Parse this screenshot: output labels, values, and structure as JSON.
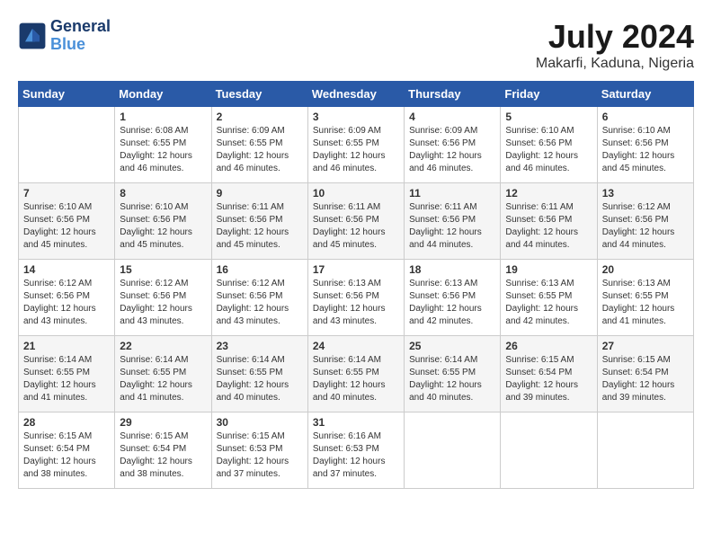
{
  "header": {
    "logo_line1": "General",
    "logo_line2": "Blue",
    "month_year": "July 2024",
    "location": "Makarfi, Kaduna, Nigeria"
  },
  "calendar": {
    "days_of_week": [
      "Sunday",
      "Monday",
      "Tuesday",
      "Wednesday",
      "Thursday",
      "Friday",
      "Saturday"
    ],
    "weeks": [
      [
        {
          "day": "",
          "sunrise": "",
          "sunset": "",
          "daylight": ""
        },
        {
          "day": "1",
          "sunrise": "Sunrise: 6:08 AM",
          "sunset": "Sunset: 6:55 PM",
          "daylight": "Daylight: 12 hours and 46 minutes."
        },
        {
          "day": "2",
          "sunrise": "Sunrise: 6:09 AM",
          "sunset": "Sunset: 6:55 PM",
          "daylight": "Daylight: 12 hours and 46 minutes."
        },
        {
          "day": "3",
          "sunrise": "Sunrise: 6:09 AM",
          "sunset": "Sunset: 6:55 PM",
          "daylight": "Daylight: 12 hours and 46 minutes."
        },
        {
          "day": "4",
          "sunrise": "Sunrise: 6:09 AM",
          "sunset": "Sunset: 6:56 PM",
          "daylight": "Daylight: 12 hours and 46 minutes."
        },
        {
          "day": "5",
          "sunrise": "Sunrise: 6:10 AM",
          "sunset": "Sunset: 6:56 PM",
          "daylight": "Daylight: 12 hours and 46 minutes."
        },
        {
          "day": "6",
          "sunrise": "Sunrise: 6:10 AM",
          "sunset": "Sunset: 6:56 PM",
          "daylight": "Daylight: 12 hours and 45 minutes."
        }
      ],
      [
        {
          "day": "7",
          "sunrise": "Sunrise: 6:10 AM",
          "sunset": "Sunset: 6:56 PM",
          "daylight": "Daylight: 12 hours and 45 minutes."
        },
        {
          "day": "8",
          "sunrise": "Sunrise: 6:10 AM",
          "sunset": "Sunset: 6:56 PM",
          "daylight": "Daylight: 12 hours and 45 minutes."
        },
        {
          "day": "9",
          "sunrise": "Sunrise: 6:11 AM",
          "sunset": "Sunset: 6:56 PM",
          "daylight": "Daylight: 12 hours and 45 minutes."
        },
        {
          "day": "10",
          "sunrise": "Sunrise: 6:11 AM",
          "sunset": "Sunset: 6:56 PM",
          "daylight": "Daylight: 12 hours and 45 minutes."
        },
        {
          "day": "11",
          "sunrise": "Sunrise: 6:11 AM",
          "sunset": "Sunset: 6:56 PM",
          "daylight": "Daylight: 12 hours and 44 minutes."
        },
        {
          "day": "12",
          "sunrise": "Sunrise: 6:11 AM",
          "sunset": "Sunset: 6:56 PM",
          "daylight": "Daylight: 12 hours and 44 minutes."
        },
        {
          "day": "13",
          "sunrise": "Sunrise: 6:12 AM",
          "sunset": "Sunset: 6:56 PM",
          "daylight": "Daylight: 12 hours and 44 minutes."
        }
      ],
      [
        {
          "day": "14",
          "sunrise": "Sunrise: 6:12 AM",
          "sunset": "Sunset: 6:56 PM",
          "daylight": "Daylight: 12 hours and 43 minutes."
        },
        {
          "day": "15",
          "sunrise": "Sunrise: 6:12 AM",
          "sunset": "Sunset: 6:56 PM",
          "daylight": "Daylight: 12 hours and 43 minutes."
        },
        {
          "day": "16",
          "sunrise": "Sunrise: 6:12 AM",
          "sunset": "Sunset: 6:56 PM",
          "daylight": "Daylight: 12 hours and 43 minutes."
        },
        {
          "day": "17",
          "sunrise": "Sunrise: 6:13 AM",
          "sunset": "Sunset: 6:56 PM",
          "daylight": "Daylight: 12 hours and 43 minutes."
        },
        {
          "day": "18",
          "sunrise": "Sunrise: 6:13 AM",
          "sunset": "Sunset: 6:56 PM",
          "daylight": "Daylight: 12 hours and 42 minutes."
        },
        {
          "day": "19",
          "sunrise": "Sunrise: 6:13 AM",
          "sunset": "Sunset: 6:55 PM",
          "daylight": "Daylight: 12 hours and 42 minutes."
        },
        {
          "day": "20",
          "sunrise": "Sunrise: 6:13 AM",
          "sunset": "Sunset: 6:55 PM",
          "daylight": "Daylight: 12 hours and 41 minutes."
        }
      ],
      [
        {
          "day": "21",
          "sunrise": "Sunrise: 6:14 AM",
          "sunset": "Sunset: 6:55 PM",
          "daylight": "Daylight: 12 hours and 41 minutes."
        },
        {
          "day": "22",
          "sunrise": "Sunrise: 6:14 AM",
          "sunset": "Sunset: 6:55 PM",
          "daylight": "Daylight: 12 hours and 41 minutes."
        },
        {
          "day": "23",
          "sunrise": "Sunrise: 6:14 AM",
          "sunset": "Sunset: 6:55 PM",
          "daylight": "Daylight: 12 hours and 40 minutes."
        },
        {
          "day": "24",
          "sunrise": "Sunrise: 6:14 AM",
          "sunset": "Sunset: 6:55 PM",
          "daylight": "Daylight: 12 hours and 40 minutes."
        },
        {
          "day": "25",
          "sunrise": "Sunrise: 6:14 AM",
          "sunset": "Sunset: 6:55 PM",
          "daylight": "Daylight: 12 hours and 40 minutes."
        },
        {
          "day": "26",
          "sunrise": "Sunrise: 6:15 AM",
          "sunset": "Sunset: 6:54 PM",
          "daylight": "Daylight: 12 hours and 39 minutes."
        },
        {
          "day": "27",
          "sunrise": "Sunrise: 6:15 AM",
          "sunset": "Sunset: 6:54 PM",
          "daylight": "Daylight: 12 hours and 39 minutes."
        }
      ],
      [
        {
          "day": "28",
          "sunrise": "Sunrise: 6:15 AM",
          "sunset": "Sunset: 6:54 PM",
          "daylight": "Daylight: 12 hours and 38 minutes."
        },
        {
          "day": "29",
          "sunrise": "Sunrise: 6:15 AM",
          "sunset": "Sunset: 6:54 PM",
          "daylight": "Daylight: 12 hours and 38 minutes."
        },
        {
          "day": "30",
          "sunrise": "Sunrise: 6:15 AM",
          "sunset": "Sunset: 6:53 PM",
          "daylight": "Daylight: 12 hours and 37 minutes."
        },
        {
          "day": "31",
          "sunrise": "Sunrise: 6:16 AM",
          "sunset": "Sunset: 6:53 PM",
          "daylight": "Daylight: 12 hours and 37 minutes."
        },
        {
          "day": "",
          "sunrise": "",
          "sunset": "",
          "daylight": ""
        },
        {
          "day": "",
          "sunrise": "",
          "sunset": "",
          "daylight": ""
        },
        {
          "day": "",
          "sunrise": "",
          "sunset": "",
          "daylight": ""
        }
      ]
    ]
  }
}
